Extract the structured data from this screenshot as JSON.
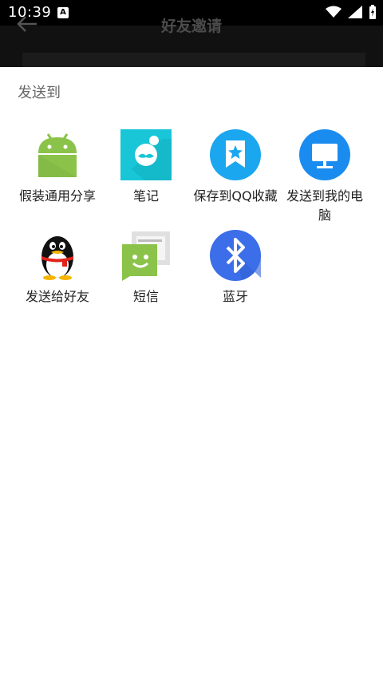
{
  "status": {
    "time": "10:39",
    "ime_icon": "A"
  },
  "appbar": {
    "title": "好友邀请"
  },
  "sheet": {
    "title": "发送到",
    "items": [
      {
        "label": "假装通用分享",
        "icon": "android-icon"
      },
      {
        "label": "笔记",
        "icon": "note-icon"
      },
      {
        "label": "保存到QQ收藏",
        "icon": "qq-favorite-icon"
      },
      {
        "label": "发送到我的电脑",
        "icon": "my-computer-icon"
      },
      {
        "label": "发送给好友",
        "icon": "qq-penguin-icon"
      },
      {
        "label": "短信",
        "icon": "messaging-icon"
      },
      {
        "label": "蓝牙",
        "icon": "bluetooth-icon"
      }
    ]
  },
  "colors": {
    "android": "#8bc34a",
    "note": "#18c6d8",
    "qqfav": "#1ba7ef",
    "computer": "#1a8cf0",
    "bluetooth": "#3b6ee8"
  }
}
